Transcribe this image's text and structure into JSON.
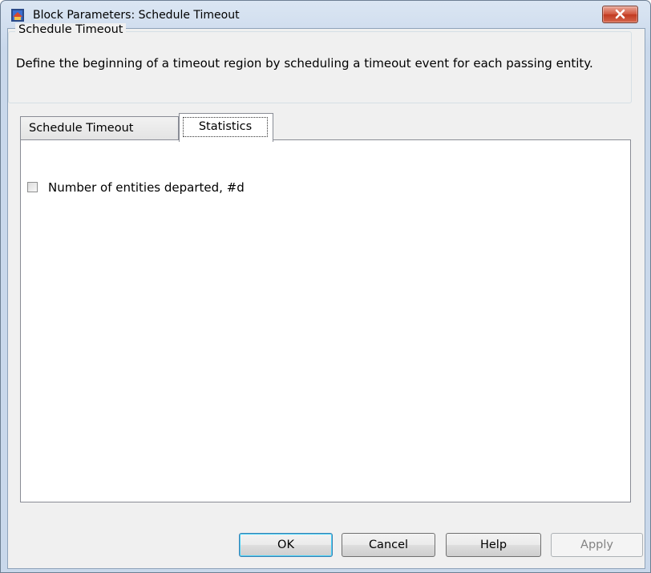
{
  "window": {
    "title": "Block Parameters: Schedule Timeout",
    "icon": "simulink-block-icon",
    "close_icon": "close-icon"
  },
  "group": {
    "legend": "Schedule Timeout",
    "description": "Define the beginning of a timeout region by scheduling a timeout event for each passing entity."
  },
  "tabs": [
    {
      "label": "Schedule Timeout",
      "selected": false
    },
    {
      "label": "Statistics",
      "selected": true
    }
  ],
  "statistics": {
    "checkbox_label": "Number of entities departed, #d",
    "checked": false
  },
  "buttons": {
    "ok": "OK",
    "cancel": "Cancel",
    "help": "Help",
    "apply": "Apply"
  },
  "colors": {
    "titlebar": "#c9d8eb",
    "close_button": "#c13a20",
    "dialog_background": "#f0f0f0",
    "default_button_border": "#3c7fb1"
  }
}
